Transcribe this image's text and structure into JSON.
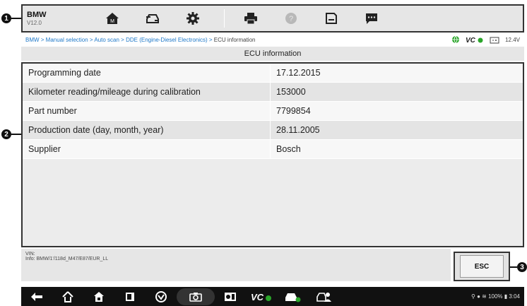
{
  "callouts": [
    "1",
    "2",
    "3"
  ],
  "toolbar": {
    "brand_name": "BMW",
    "brand_version": "V12.0",
    "icons": [
      "home-icon",
      "vehicle-swap-icon",
      "settings-icon",
      "print-icon",
      "help-icon",
      "save-icon",
      "chat-icon"
    ]
  },
  "breadcrumb": {
    "path": "BMW > Manual selection > Auto scan > DDE (Engine-Diesel Electronics) > ",
    "current": "ECU information",
    "voltage": "12.4V"
  },
  "title": "ECU information",
  "table": {
    "rows": [
      [
        "Programming date",
        "17.12.2015"
      ],
      [
        "Kilometer reading/mileage during calibration",
        "153000"
      ],
      [
        "Part number",
        "7799854"
      ],
      [
        "Production date (day, month, year)",
        "28.11.2005"
      ],
      [
        "Supplier",
        "Bosch"
      ]
    ]
  },
  "vin": {
    "label": "VIN:",
    "info": "Info: BMW/1'/118d_M47/E87/EUR_LL"
  },
  "esc_label": "ESC",
  "status": {
    "battery": "100%",
    "time": "3:04"
  },
  "colors": {
    "accent_link": "#1e78c8",
    "vci_green": "#2aa52a"
  }
}
